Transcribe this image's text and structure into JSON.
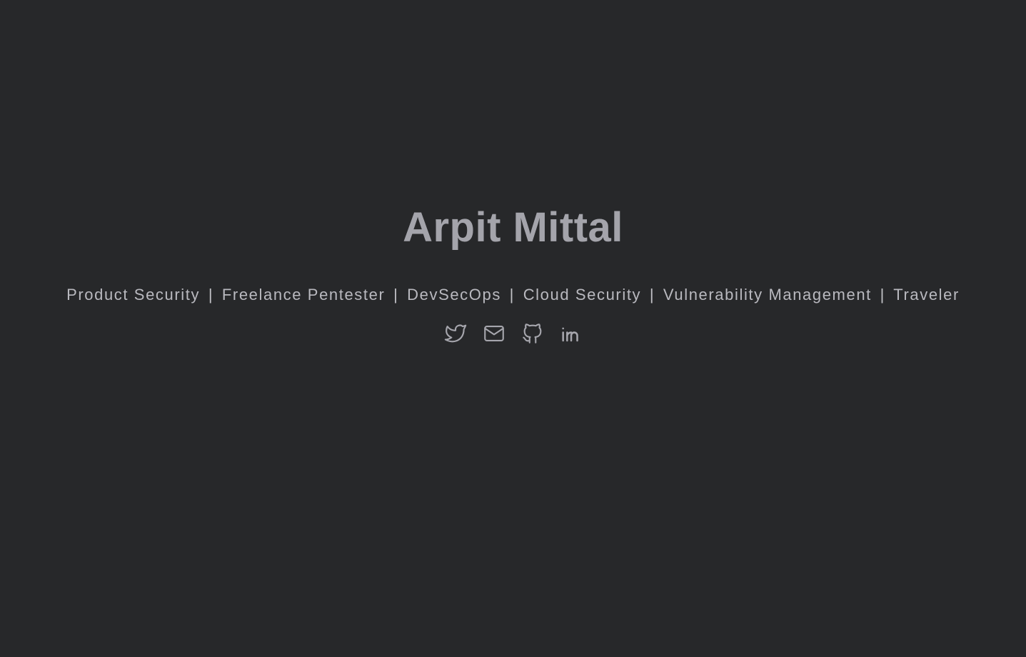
{
  "profile": {
    "name": "Arpit Mittal",
    "tagline_items": [
      "Product Security",
      "Freelance Pentester",
      "DevSecOps",
      "Cloud Security",
      "Vulnerability Management",
      "Traveler"
    ],
    "separator": "|"
  },
  "social_links": [
    {
      "icon": "twitter-icon"
    },
    {
      "icon": "mail-icon"
    },
    {
      "icon": "github-icon"
    },
    {
      "icon": "linkedin-icon"
    }
  ],
  "colors": {
    "background": "#27282a",
    "name": "#a4a4ab",
    "tagline": "#b9b9bf",
    "icons": "#a6a6ad"
  }
}
